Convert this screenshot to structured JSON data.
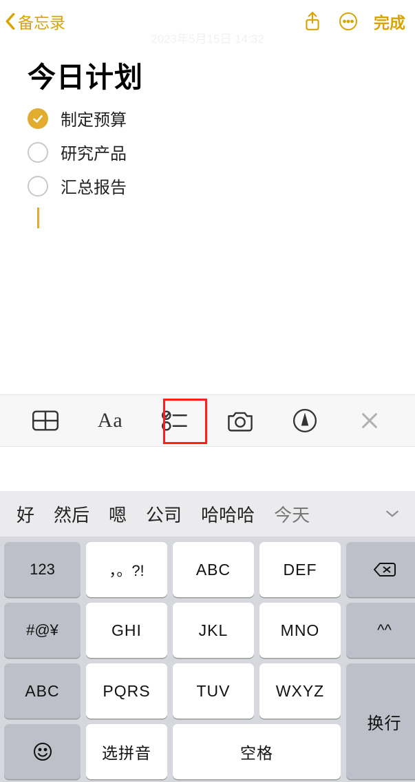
{
  "nav": {
    "back_label": "备忘录",
    "done_label": "完成"
  },
  "date_ghost": "2023年5月15日 14:32",
  "note": {
    "title": "今日计划",
    "items": [
      {
        "text": "制定预算",
        "checked": true
      },
      {
        "text": "研究产品",
        "checked": false
      },
      {
        "text": "汇总报告",
        "checked": false
      }
    ]
  },
  "format_bar": {
    "aa_label": "Aa"
  },
  "suggestions": [
    "好",
    "然后",
    "嗯",
    "公司",
    "哈哈哈",
    "今天"
  ],
  "keyboard": {
    "k123": "123",
    "punc": "，。?!",
    "abc": "ABC",
    "def": "DEF",
    "sym": "#@¥",
    "ghi": "GHI",
    "jkl": "JKL",
    "mno": "MNO",
    "face": "^^",
    "shift_abc": "ABC",
    "pqrs": "PQRS",
    "tuv": "TUV",
    "wxyz": "WXYZ",
    "ret": "换行",
    "pinyin": "选拼音",
    "space": "空格"
  }
}
